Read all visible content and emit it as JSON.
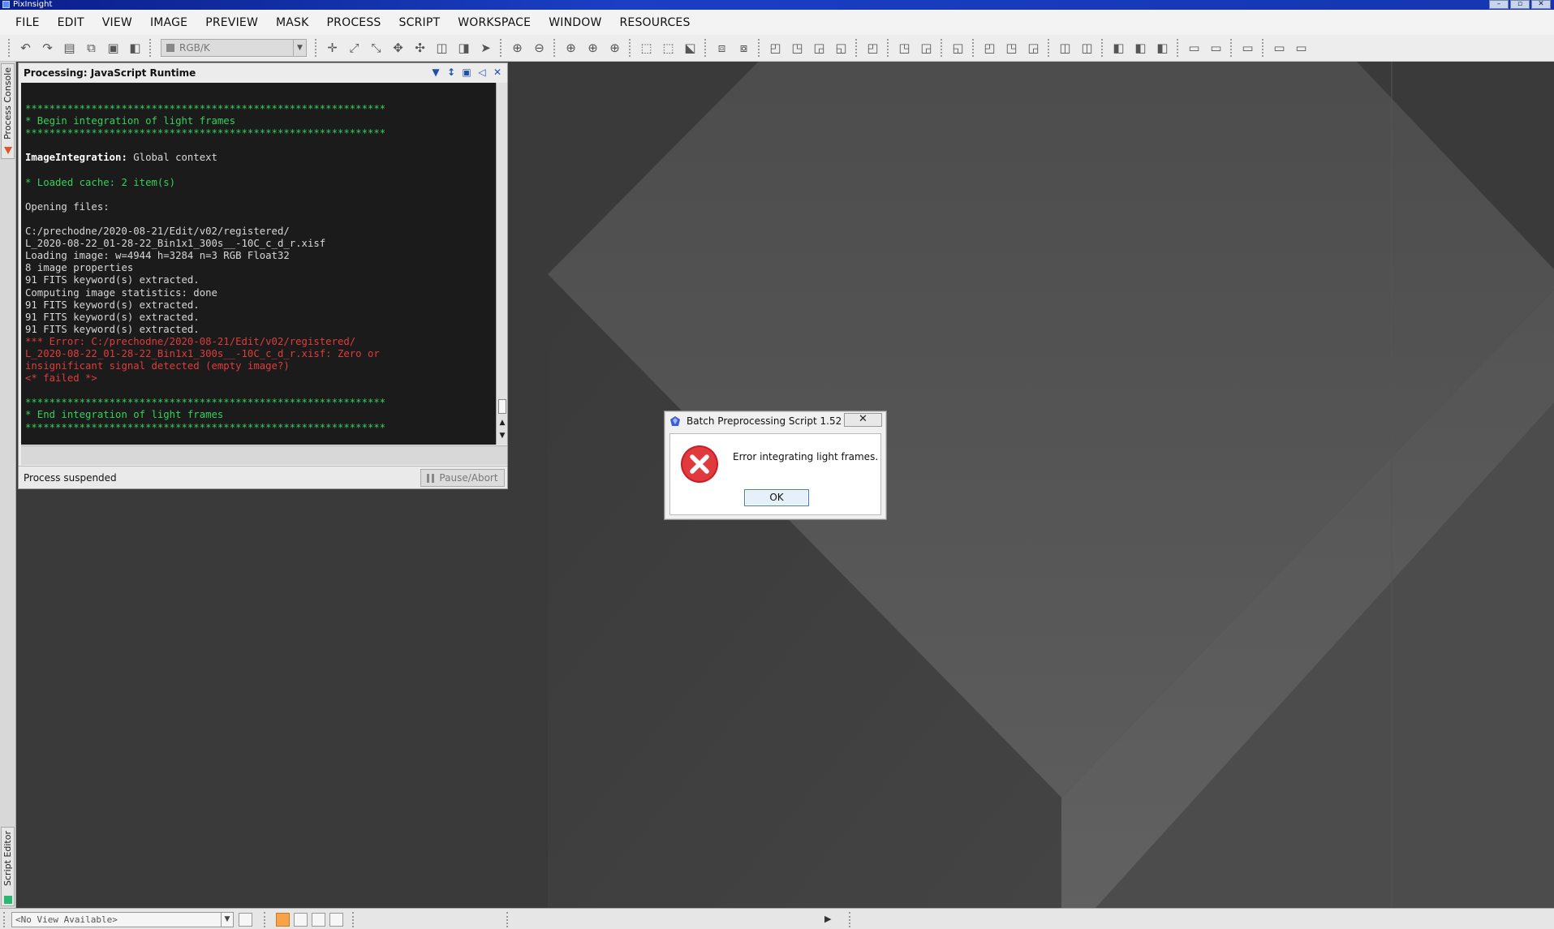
{
  "window": {
    "title": "PixInsight",
    "buttons": [
      "–",
      "▫",
      "✕"
    ]
  },
  "menu": {
    "items": [
      "FILE",
      "EDIT",
      "VIEW",
      "IMAGE",
      "PREVIEW",
      "MASK",
      "PROCESS",
      "SCRIPT",
      "WORKSPACE",
      "WINDOW",
      "RESOURCES"
    ]
  },
  "toolbar": {
    "color_space": "RGB/K"
  },
  "sidebar": {
    "top_tab": "Process Console",
    "bottom_tab": "Script Editor"
  },
  "console": {
    "title": "Processing: JavaScript Runtime",
    "lines": [
      {
        "t": "",
        "c": "blank"
      },
      {
        "t": "************************************************************",
        "c": "green"
      },
      {
        "t": "* Begin integration of light frames",
        "c": "green"
      },
      {
        "t": "************************************************************",
        "c": "green"
      },
      {
        "t": "",
        "c": "blank"
      },
      {
        "t": "ImageIntegration:",
        "rest": " Global context",
        "c": "bold"
      },
      {
        "t": "",
        "c": "blank"
      },
      {
        "t": "* Loaded cache: 2 item(s)",
        "c": "green"
      },
      {
        "t": "",
        "c": "blank"
      },
      {
        "t": "Opening files:",
        "c": ""
      },
      {
        "t": "",
        "c": "blank"
      },
      {
        "t": "C:/prechodne/2020-08-21/Edit/v02/registered/",
        "c": ""
      },
      {
        "t": "L_2020-08-22_01-28-22_Bin1x1_300s__-10C_c_d_r.xisf",
        "c": ""
      },
      {
        "t": "Loading image: w=4944 h=3284 n=3 RGB Float32",
        "c": ""
      },
      {
        "t": "8 image properties",
        "c": ""
      },
      {
        "t": "91 FITS keyword(s) extracted.",
        "c": ""
      },
      {
        "t": "Computing image statistics: done",
        "c": ""
      },
      {
        "t": "91 FITS keyword(s) extracted.",
        "c": ""
      },
      {
        "t": "91 FITS keyword(s) extracted.",
        "c": ""
      },
      {
        "t": "91 FITS keyword(s) extracted.",
        "c": ""
      },
      {
        "t": "*** Error: C:/prechodne/2020-08-21/Edit/v02/registered/",
        "c": "red"
      },
      {
        "t": "L_2020-08-22_01-28-22_Bin1x1_300s__-10C_c_d_r.xisf: Zero or",
        "c": "red"
      },
      {
        "t": "insignificant signal detected (empty image?)",
        "c": "red"
      },
      {
        "t": "<* failed *>",
        "c": "red"
      },
      {
        "t": "",
        "c": "blank"
      },
      {
        "t": "************************************************************",
        "c": "green"
      },
      {
        "t": "* End integration of light frames",
        "c": "green"
      },
      {
        "t": "************************************************************",
        "c": "green"
      }
    ],
    "status": "Process suspended",
    "pause_label": "Pause/Abort"
  },
  "dialog": {
    "title": "Batch Preprocessing Script 1.52",
    "message": "Error integrating light frames.",
    "ok_label": "OK",
    "close_glyph": "✕"
  },
  "statusbar": {
    "view_selector": "<No View Available>"
  },
  "colors": {
    "console_bg": "#1b1b1b",
    "console_green": "#34d05a",
    "console_red": "#e03c3c",
    "error_icon": "#d9262c",
    "titlebar": "#1a3fc4"
  }
}
